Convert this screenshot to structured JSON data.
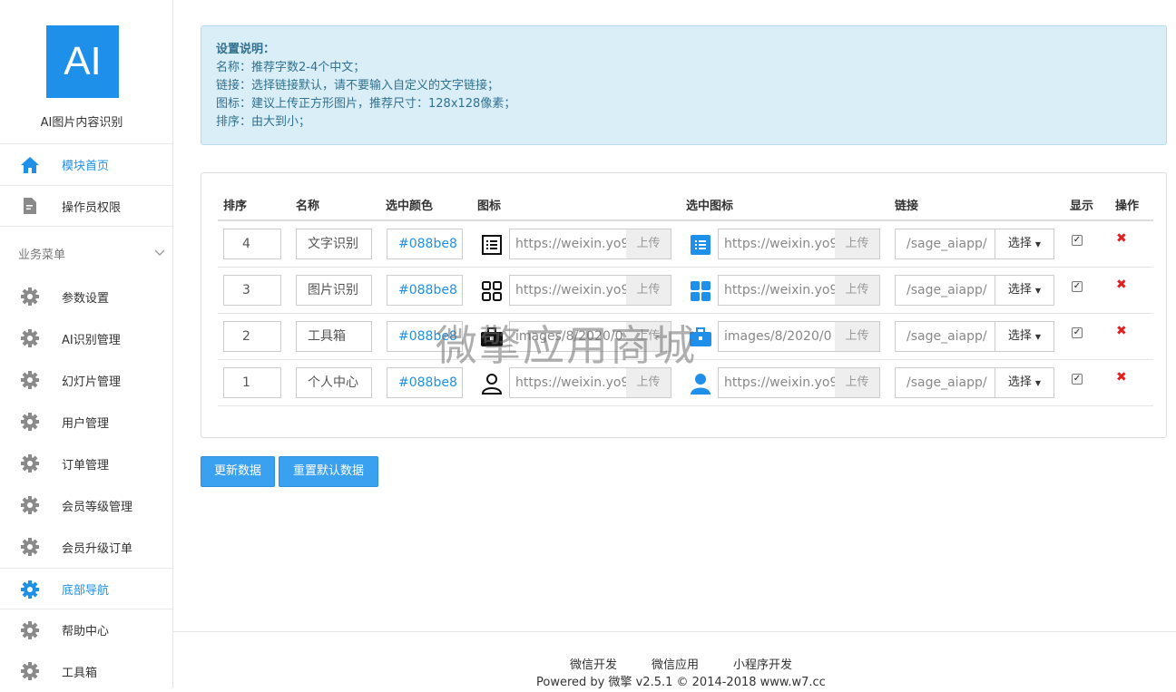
{
  "sidebar": {
    "logo_text": "AI",
    "app_name": "AI图片内容识别",
    "items_top": [
      {
        "label": "模块首页",
        "icon": "home-icon",
        "active": true
      },
      {
        "label": "操作员权限",
        "icon": "document-edit-icon",
        "active": false
      }
    ],
    "group_title": "业务菜单",
    "items": [
      {
        "label": "参数设置"
      },
      {
        "label": "AI识别管理"
      },
      {
        "label": "幻灯片管理"
      },
      {
        "label": "用户管理"
      },
      {
        "label": "订单管理"
      },
      {
        "label": "会员等级管理"
      },
      {
        "label": "会员升级订单"
      },
      {
        "label": "底部导航"
      },
      {
        "label": "帮助中心"
      },
      {
        "label": "工具箱"
      }
    ]
  },
  "notice": {
    "title": "设置说明：",
    "lines": [
      "名称：推荐字数2-4个中文；",
      "链接：选择链接默认，请不要输入自定义的文字链接；",
      "图标：建议上传正方形图片，推荐尺寸：128x128像素；",
      "排序：由大到小；"
    ]
  },
  "table": {
    "headers": [
      "排序",
      "名称",
      "选中颜色",
      "图标",
      "选中图标",
      "链接",
      "显示",
      "操作"
    ],
    "upload_label": "上传",
    "select_label": "选择",
    "rows": [
      {
        "order": "4",
        "name": "文字识别",
        "color": "#088be8",
        "icon": "list-document-icon",
        "icon_url": "https://weixin.yo9",
        "sel_icon": "list-document-filled-icon",
        "sel_icon_url": "https://weixin.yo9",
        "link": "/sage_aiapp/",
        "show": true
      },
      {
        "order": "3",
        "name": "图片识别",
        "color": "#088be8",
        "icon": "grid-icon",
        "icon_url": "https://weixin.yo9",
        "sel_icon": "grid-filled-icon",
        "sel_icon_url": "https://weixin.yo9",
        "link": "/sage_aiapp/",
        "show": true
      },
      {
        "order": "2",
        "name": "工具箱",
        "color": "#088be8",
        "icon": "briefcase-icon",
        "icon_url": "images/8/2020/0",
        "sel_icon": "briefcase-filled-icon",
        "sel_icon_url": "images/8/2020/0",
        "link": "/sage_aiapp/",
        "show": true
      },
      {
        "order": "1",
        "name": "个人中心",
        "color": "#088be8",
        "icon": "user-icon",
        "icon_url": "https://weixin.yo9",
        "sel_icon": "user-filled-icon",
        "sel_icon_url": "https://weixin.yo9",
        "link": "/sage_aiapp/",
        "show": true
      }
    ]
  },
  "buttons": {
    "update": "更新数据",
    "reset": "重置默认数据"
  },
  "watermark": "微擎应用商城",
  "footer": {
    "links": [
      "微信开发",
      "微信应用",
      "小程序开发"
    ],
    "copyright": "Powered by 微擎 v2.5.1 © 2014-2018 www.w7.cc"
  },
  "colors": {
    "accent": "#1e90ea",
    "notice_bg": "#d9eef7",
    "delete": "#e02020"
  }
}
